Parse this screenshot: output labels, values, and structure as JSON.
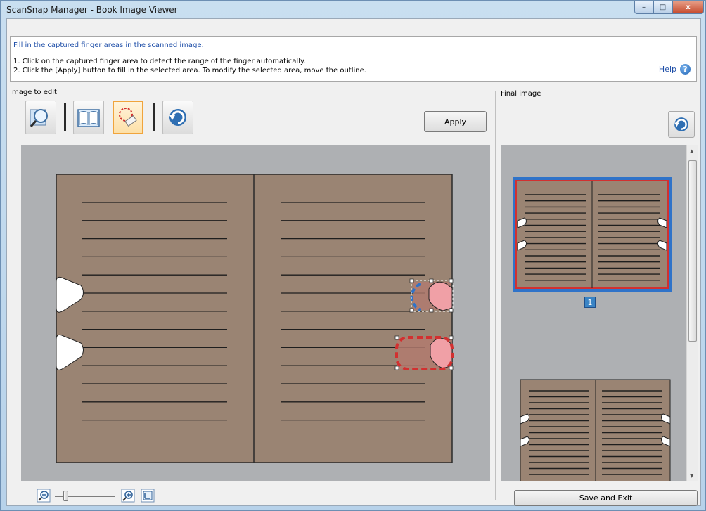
{
  "window": {
    "title": "ScanSnap Manager - Book Image Viewer",
    "controls": {
      "minimize": "–",
      "maximize": "□",
      "close": "x"
    }
  },
  "instructions": {
    "heading": "Fill in the captured finger areas in the scanned image.",
    "line1": "1. Click on the captured finger area to detect the range of the finger automatically.",
    "line2": "2. Click the [Apply] button to fill in the selected area. To modify the selected area, move the outline.",
    "help_label": "Help",
    "help_icon": "?"
  },
  "left_panel": {
    "label": "Image to edit",
    "tools": [
      "magnifier-icon",
      "book-crop-icon",
      "finger-fill-eraser-icon",
      "undo-icon"
    ],
    "apply_label": "Apply"
  },
  "right_panel": {
    "label": "Final image",
    "page_number": "1"
  },
  "zoom": {
    "tools": [
      "zoom-out-icon",
      "zoom-slider",
      "zoom-in-icon",
      "fit-icon"
    ],
    "level": 0.15
  },
  "save_exit_label": "Save and Exit",
  "colors": {
    "page": "#9a8473",
    "selected_blue": "#2f73c9",
    "selected_red": "#d23030",
    "fill_pink": "#f0a0a6"
  }
}
